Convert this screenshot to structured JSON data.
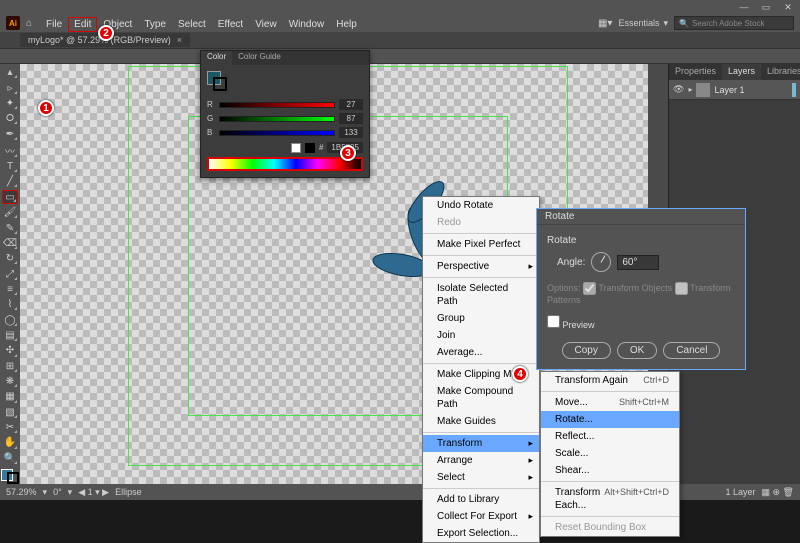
{
  "app": {
    "name": "Ai"
  },
  "menubar": {
    "items": [
      "File",
      "Edit",
      "Object",
      "Type",
      "Select",
      "Effect",
      "View",
      "Window",
      "Help"
    ],
    "highlight_index": 1
  },
  "workspace_switcher": "Essentials",
  "search": {
    "placeholder": "Search Adobe Stock"
  },
  "doc_tab": {
    "title": "myLogo* @ 57.29% (RGB/Preview)",
    "close": "×"
  },
  "tools": [
    "sel",
    "dsel",
    "wand",
    "lasso",
    "pen",
    "curv",
    "type",
    "line",
    "rect",
    "brush",
    "pencil",
    "erase",
    "rot",
    "scale",
    "width",
    "warp",
    "shape",
    "grad",
    "drop",
    "mesh",
    "sym",
    "col",
    "art",
    "slice",
    "hand",
    "zoom"
  ],
  "selected_tool_index": 8,
  "panels": {
    "tabs": [
      "Properties",
      "Layers",
      "Libraries"
    ],
    "active_tab": 1,
    "layers": [
      {
        "name": "Layer 1"
      }
    ]
  },
  "color_panel": {
    "tabs": [
      "Color",
      "Color Guide"
    ],
    "rgb": {
      "r": 27,
      "g": 87,
      "b": 133
    },
    "hex": "1B5785"
  },
  "context_menu": {
    "items": [
      {
        "label": "Undo Rotate"
      },
      {
        "label": "Redo",
        "disabled": true
      },
      {
        "sep": true
      },
      {
        "label": "Make Pixel Perfect"
      },
      {
        "sep": true
      },
      {
        "label": "Perspective",
        "arrow": true
      },
      {
        "sep": true
      },
      {
        "label": "Isolate Selected Path"
      },
      {
        "label": "Group"
      },
      {
        "label": "Join"
      },
      {
        "label": "Average..."
      },
      {
        "sep": true
      },
      {
        "label": "Make Clipping Mask"
      },
      {
        "label": "Make Compound Path"
      },
      {
        "label": "Make Guides"
      },
      {
        "sep": true
      },
      {
        "label": "Transform",
        "arrow": true,
        "highlight": true
      },
      {
        "label": "Arrange",
        "arrow": true
      },
      {
        "label": "Select",
        "arrow": true
      },
      {
        "sep": true
      },
      {
        "label": "Add to Library"
      },
      {
        "label": "Collect For Export",
        "arrow": true
      },
      {
        "label": "Export Selection..."
      }
    ]
  },
  "transform_submenu": {
    "items": [
      {
        "label": "Transform Again",
        "shortcut": "Ctrl+D"
      },
      {
        "sep": true
      },
      {
        "label": "Move...",
        "shortcut": "Shift+Ctrl+M"
      },
      {
        "label": "Rotate...",
        "highlight": true
      },
      {
        "label": "Reflect..."
      },
      {
        "label": "Scale..."
      },
      {
        "label": "Shear..."
      },
      {
        "sep": true
      },
      {
        "label": "Transform Each...",
        "shortcut": "Alt+Shift+Ctrl+D"
      },
      {
        "sep": true
      },
      {
        "label": "Reset Bounding Box",
        "disabled": true
      }
    ]
  },
  "rotate_dialog": {
    "title": "Rotate",
    "section": "Rotate",
    "angle_label": "Angle:",
    "angle_value": "60°",
    "options_label": "Options:",
    "opt_objects": "Transform Objects",
    "opt_patterns": "Transform Patterns",
    "preview": "Preview",
    "copy": "Copy",
    "ok": "OK",
    "cancel": "Cancel"
  },
  "status": {
    "zoom": "57.29%",
    "rot": "0°",
    "artboard": "1",
    "tool": "Ellipse",
    "layers": "1 Layer"
  },
  "callouts": [
    "1",
    "2",
    "3",
    "4"
  ]
}
